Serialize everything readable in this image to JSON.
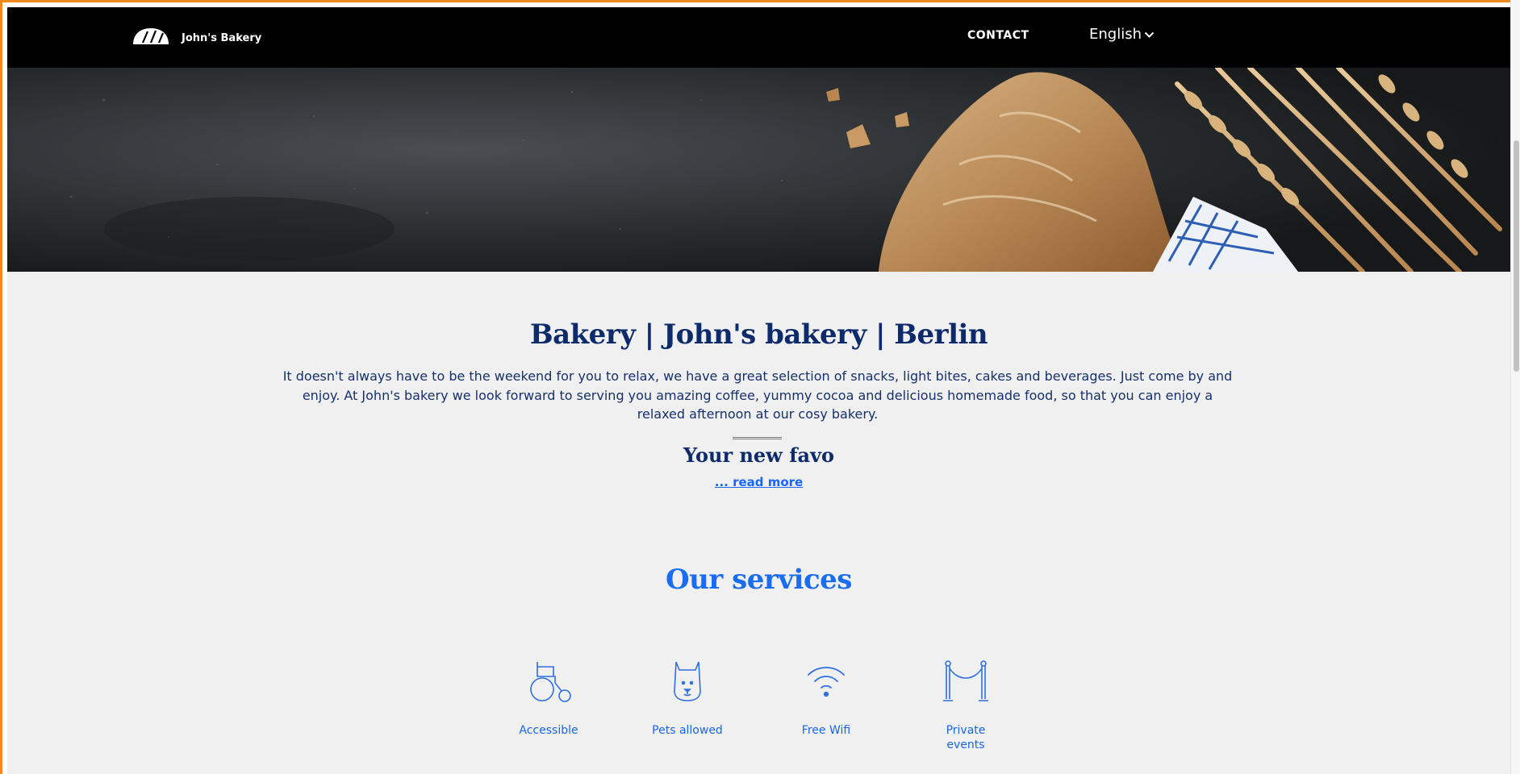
{
  "header": {
    "logo_text": "John's Bakery",
    "nav_contact": "CONTACT",
    "language": "English"
  },
  "intro": {
    "title": "Bakery | John's bakery | Berlin",
    "text": "It doesn't always have to be the weekend for you to relax, we have a great selection of snacks, light bites, cakes and beverages. Just come by and enjoy. At John's bakery we look forward to serving you amazing coffee, yummy cocoa and delicious homemade food, so that you can enjoy a relaxed afternoon at our cosy bakery.",
    "subtitle": "Your new favo",
    "read_more": "... read more"
  },
  "services": {
    "title": "Our services",
    "items": [
      {
        "label": "Accessible",
        "icon": "wheelchair-icon"
      },
      {
        "label": "Pets allowed",
        "icon": "dog-icon"
      },
      {
        "label": "Free Wifi",
        "icon": "wifi-icon"
      },
      {
        "label": "Private events",
        "icon": "rope-barrier-icon"
      }
    ]
  },
  "colors": {
    "header_bg": "#000000",
    "page_bg": "#f0f0f0",
    "title": "#0d2b6b",
    "accent": "#1a6cf0",
    "frame": "#f08a1c"
  }
}
